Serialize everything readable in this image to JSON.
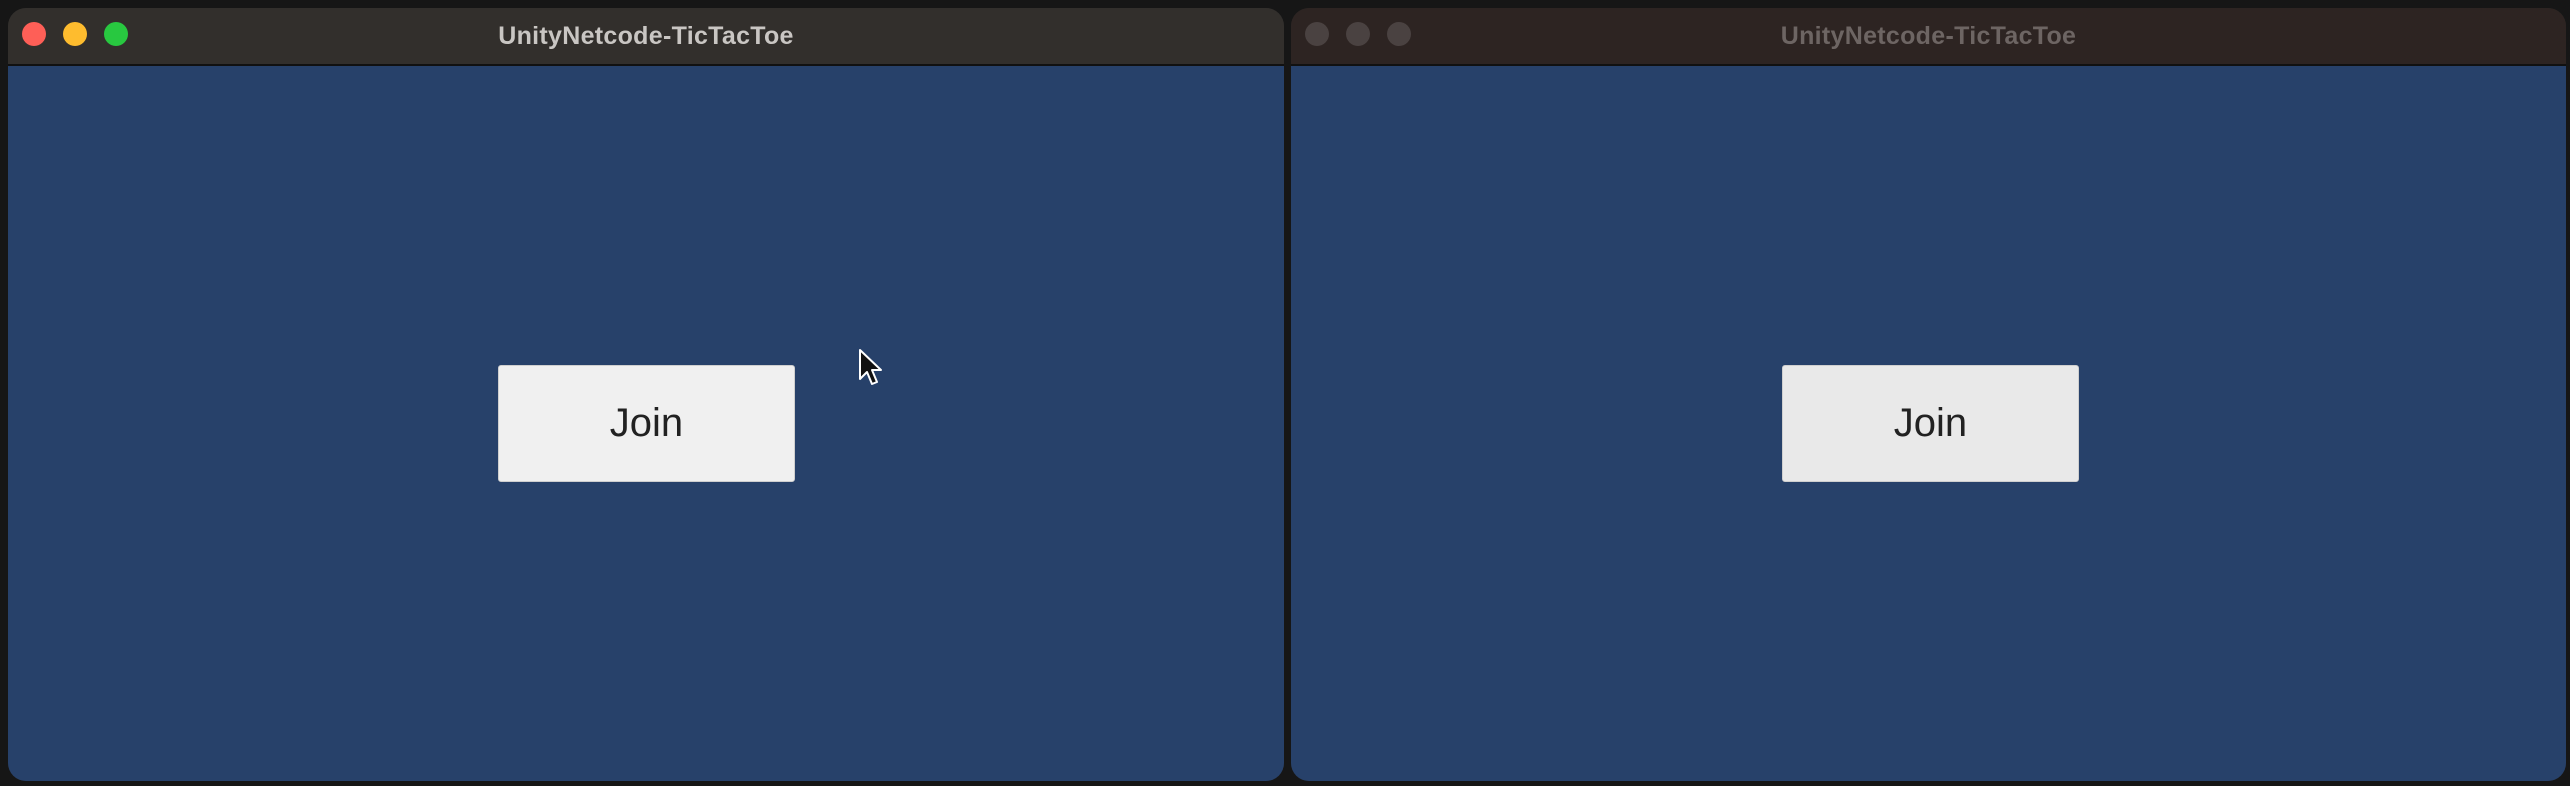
{
  "windows": [
    {
      "title": "UnityNetcode-TicTacToe",
      "active": true,
      "join_label": "Join"
    },
    {
      "title": "UnityNetcode-TicTacToe",
      "active": false,
      "join_label": "Join"
    }
  ],
  "colors": {
    "content_background": "#27416a",
    "button_background": "#f0f0f0",
    "close": "#fe5f57",
    "minimize": "#febc2e",
    "maximize": "#28c840"
  },
  "icons": {
    "pointer": "mouse-cursor-icon"
  }
}
